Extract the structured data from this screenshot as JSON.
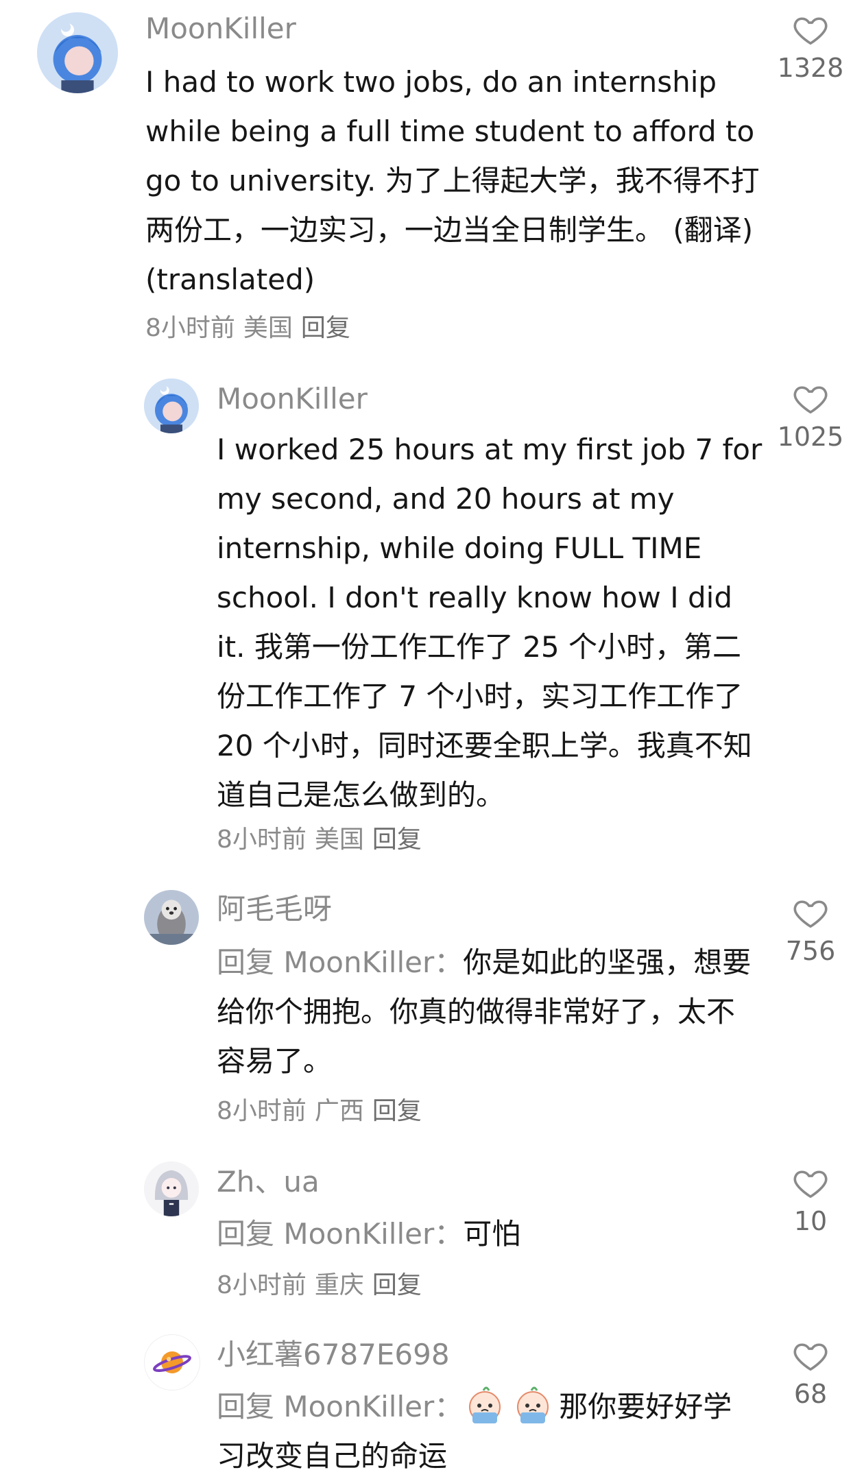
{
  "comments": [
    {
      "username": "MoonKiller",
      "text": "I had to work two jobs, do an internship while being a full time student to afford to go to university. 为了上得起大学，我不得不打两份工，一边实习，一边当全日制学生。 (翻译) (translated)",
      "time": "8小时前",
      "location": "美国",
      "reply_label": "回复",
      "likes": "1328",
      "avatar_icon": "anime-avatar-blue-hair"
    },
    {
      "username": "MoonKiller",
      "text": "I worked 25 hours at my first job 7 for my second, and 20 hours at my internship, while doing FULL TIME school. I don't really know how I did it. 我第一份工作工作了 25 个小时，第二份工作工作了 7 个小时，实习工作工作了 20 个小时，同时还要全职上学。我真不知道自己是怎么做到的。",
      "time": "8小时前",
      "location": "美国",
      "reply_label": "回复",
      "likes": "1025",
      "avatar_icon": "anime-avatar-blue-hair"
    },
    {
      "username": "阿毛毛呀",
      "reply_prefix": "回复 MoonKiller：",
      "text": "你是如此的坚强，想要给你个拥抱。你真的做得非常好了，太不容易了。",
      "time": "8小时前",
      "location": "广西",
      "reply_label": "回复",
      "likes": "756",
      "avatar_icon": "otter-photo-avatar"
    },
    {
      "username": "Zh、ua",
      "reply_prefix": "回复 MoonKiller：",
      "text": "可怕",
      "time": "8小时前",
      "location": "重庆",
      "reply_label": "回复",
      "likes": "10",
      "avatar_icon": "anime-avatar-silver-hair"
    },
    {
      "username": "小红薯6787E698",
      "reply_prefix": "回复 MoonKiller：",
      "text": "那你要好好学习改变自己的命运",
      "time": "",
      "location": "",
      "reply_label": "",
      "likes": "68",
      "avatar_icon": "planet-avatar",
      "emoji_icons": [
        "crying-face-emoji",
        "crying-face-emoji"
      ]
    }
  ],
  "icons": {
    "like": "heart-outline-icon"
  },
  "colors": {
    "secondary_text": "#8a8a8a",
    "primary_text": "#161616",
    "background": "#ffffff"
  }
}
